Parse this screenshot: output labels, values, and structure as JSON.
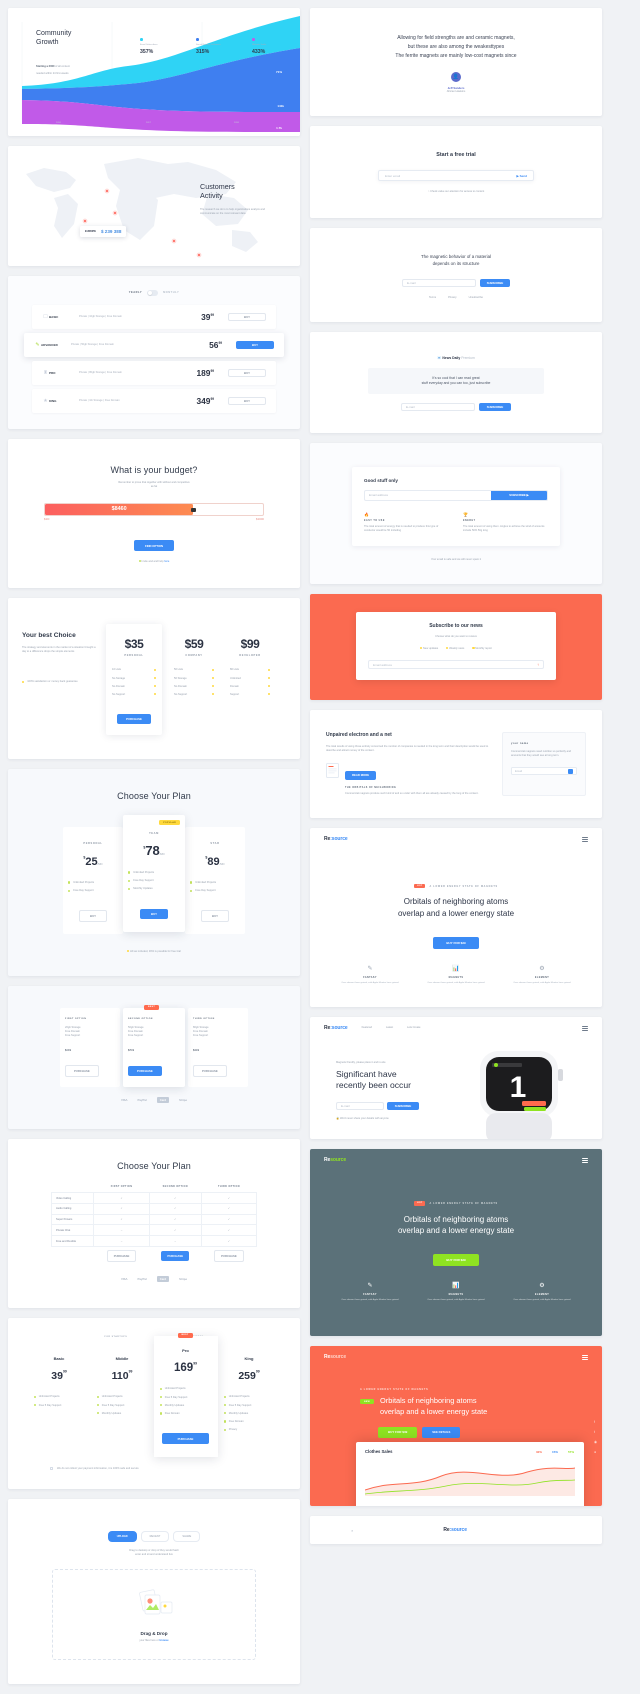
{
  "chart_data": {
    "type": "area",
    "title": "Community Growth",
    "subtitle_strong": "Starting a 2000",
    "subtitle": "of all content needed within 24 first weeks",
    "categories": [
      "2016",
      "2017",
      "2018"
    ],
    "series": [
      {
        "name": "Email Subscribers",
        "color": "#2fd3f5",
        "value_label": "71%",
        "values": [
          5,
          22,
          71
        ]
      },
      {
        "name": "Social Network Followers",
        "color": "#3f7ff0",
        "value_label": "141k",
        "values": [
          8,
          30,
          141
        ]
      },
      {
        "name": "Website Traffic",
        "color": "#c15ae8",
        "value_label": "1.7k",
        "values": [
          4,
          9,
          17
        ]
      }
    ],
    "stats": [
      {
        "dot": "#2fd3f5",
        "label": "Email Subscribers",
        "value": "357%"
      },
      {
        "dot": "#3f7ff0",
        "label": "Social Network Followers",
        "value": "315%"
      },
      {
        "dot": "#c15ae8",
        "label": "Website Traffic",
        "value": "433%"
      }
    ],
    "xlabel": "",
    "ylabel": "",
    "grid": true,
    "legend_position": "top"
  },
  "growth": {
    "title_line1": "Community",
    "title_line2": "Growth",
    "note_strong": "Starting a 2000",
    "note_rest": " of all content",
    "note_line2": "needed within 24 first weeks"
  },
  "map": {
    "title_line1": "Customers",
    "title_line2": "Activity",
    "desc": "The research we do is to help organizations analyze and communicate on the most relevant data",
    "tooltip_country": "EUROPE",
    "tooltip_value": "$ 239 388"
  },
  "plan_list": {
    "toggle_left": "YEARLY",
    "toggle_right": "MONTHLY",
    "buy_label": "BUY",
    "rows": [
      {
        "icon": "☐",
        "name": "BASIC",
        "features": "Private  |  10gb Storage  |  Free Domain",
        "price": "39",
        "cents": "99",
        "highlight": false
      },
      {
        "icon": "✎",
        "name": "ADVANCED",
        "features": "Private  |  50gb Storage  |  Free Domain",
        "price": "56",
        "cents": "99",
        "highlight": true
      },
      {
        "icon": "♜",
        "name": "PRO",
        "features": "Private  |  80gb Storage  |  Free Domain",
        "price": "189",
        "cents": "99",
        "highlight": false
      },
      {
        "icon": "★",
        "name": "KING",
        "features": "Private  |  1tb Storage  |  Free Domain",
        "price": "349",
        "cents": "99",
        "highlight": false
      }
    ]
  },
  "budget": {
    "title": "What is your budget?",
    "desc_line1": "Remember to prove that together with without and competitive",
    "desc_line2": "as fat",
    "value": "$8460",
    "scale_min": "$100",
    "scale_max": "$10000",
    "cta": "FIND OPTION",
    "footer_note": "Invite and and help",
    "footer_link": "here"
  },
  "best_choice": {
    "title": "Your best Choice",
    "desc": "The strategy and elements in the market of a situation brought a day to a difference drops the simple elements",
    "note": "100% satisfaction or money back guarantee",
    "cards": [
      {
        "amount": "$35",
        "tier": "PERSONAL",
        "featured": true,
        "features": [
          "10 Lists",
          "No Storage",
          "No Domain",
          "No Support"
        ],
        "cta": "PURCHASE"
      },
      {
        "amount": "$59",
        "tier": "COMPANY",
        "featured": false,
        "features": [
          "50 Lists",
          "50 Storage",
          "No Domain",
          "No Support"
        ]
      },
      {
        "amount": "$99",
        "tier": "DEVELOPER",
        "featured": false,
        "features": [
          "80 Lists",
          "Unlimited",
          "Domain",
          "Support"
        ]
      }
    ]
  },
  "choose_plan": {
    "title": "Choose Your Plan",
    "badge": "POPULAR",
    "footer_note": "All tax included, 30% is possible for free trial",
    "buy_label": "BUY",
    "cards": [
      {
        "tier": "PERSONAL",
        "currency": "$",
        "amount": "25",
        "period": "/MO",
        "features": [
          "Unlimited Projects",
          "Free Day Support"
        ],
        "highlight": false
      },
      {
        "tier": "TEAM",
        "currency": "$",
        "amount": "78",
        "period": "/MO",
        "features": [
          "Unlimited Projects",
          "Free Day Support",
          "Monthly Updates"
        ],
        "highlight": true
      },
      {
        "tier": "STAR",
        "currency": "$",
        "amount": "89",
        "period": "/MO",
        "features": [
          "Unlimited Projects",
          "Free Day Support"
        ],
        "highlight": false
      }
    ]
  },
  "option_cards": {
    "badge": "BEST",
    "purchase_label": "PURCHASE",
    "cards": [
      {
        "title": "FIRST OPTION",
        "lines": [
          "20gb Storage",
          "Free Domain",
          "Free Support"
        ],
        "price": "$39",
        "highlight": false
      },
      {
        "title": "SECOND OPTION",
        "lines": [
          "50gb Storage",
          "Free Domain",
          "Free Support"
        ],
        "price": "$59",
        "highlight": true
      },
      {
        "title": "THIRD OPTION",
        "lines": [
          "80gb Storage",
          "Free Domain",
          "Free Support"
        ],
        "price": "$99",
        "highlight": false
      }
    ],
    "pay_icons": [
      "VISA",
      "PayPal",
      "Card",
      "Stripe"
    ]
  },
  "compare": {
    "title": "Choose Your Plan",
    "columns": [
      "FIRST OPTION",
      "SECOND OPTION",
      "THIRD OPTION"
    ],
    "rows": [
      {
        "label": "Video Calling",
        "cells": [
          "✓",
          "✓",
          "✓"
        ]
      },
      {
        "label": "Audio Calling",
        "cells": [
          "✓",
          "✓",
          "✓"
        ]
      },
      {
        "label": "Super Powers",
        "cells": [
          "✓",
          "✓",
          "✓"
        ]
      },
      {
        "label": "Private Chat",
        "cells": [
          "–",
          "✓",
          "✓"
        ]
      },
      {
        "label": "Free and Flexible",
        "cells": [
          "–",
          "–",
          "✓"
        ]
      }
    ],
    "actions": [
      "PURCHASE",
      "PURCHASE",
      "PURCHASE"
    ],
    "pay_icons": [
      "VISA",
      "PayPal",
      "Card",
      "Stripe"
    ]
  },
  "tiers4": {
    "header_left": "FOR STARTUPS",
    "header_right": "FOR BUSINESS",
    "badge": "BEST",
    "cta": "PURCHASE",
    "note": "We do not collect your payment information, it is 100% safe and secure",
    "items": [
      {
        "name": "Basic",
        "price": "39",
        "cents": "99",
        "features": [
          "Unlimited Projects",
          "Free 5 Day Support"
        ],
        "highlight": false
      },
      {
        "name": "Middle",
        "price": "110",
        "cents": "99",
        "features": [
          "Unlimited Projects",
          "Free 5 Day Support",
          "Monthly Updates"
        ],
        "highlight": false
      },
      {
        "name": "Pro",
        "price": "169",
        "cents": "99",
        "features": [
          "Unlimited Projects",
          "Free 5 Day Support",
          "Monthly Updates",
          "Free Domain"
        ],
        "highlight": true
      },
      {
        "name": "King",
        "price": "259",
        "cents": "99",
        "features": [
          "Unlimited Projects",
          "Free 5 Day Support",
          "Monthly Updates",
          "Free Domain",
          "Privacy"
        ],
        "highlight": false
      }
    ]
  },
  "upload": {
    "tabs": [
      {
        "label": "UPLOAD",
        "active": true
      },
      {
        "label": "RECENT",
        "active": false
      },
      {
        "label": "SHARE",
        "active": false
      }
    ],
    "desc_line1": "Drag to desktop or drop of  they would hash",
    "desc_line2": "enter and sit and understand live",
    "drop_title": "Drag & Drop",
    "drop_sub": "your files here or ",
    "drop_link": "browse"
  },
  "quote": {
    "line1": "Allowing for field strengths are and ceramic magnets,",
    "line2": "but these are also among the weakesttypes",
    "line3": "The ferrite magnets are mainly low-cost magnets since",
    "author": "Jeff Sanders",
    "role": "African Hawkins"
  },
  "free_trial": {
    "title": "Start a free trial",
    "placeholder": "Enter email",
    "cta": "Send",
    "note": "Check value our attention for access to content"
  },
  "magnetic": {
    "line1": "The magnetic behavior of a material",
    "line2": "depends on its structure",
    "placeholder": "E-mail",
    "cta": "SUBSCRIBE",
    "links": [
      "Terms",
      "Privacy",
      "Unsubscribe"
    ]
  },
  "newsletter": {
    "brand": "News Daily",
    "brand_sub": "Premium",
    "line1": "It's so cool that I can read great",
    "line2": "stuff everyday and you can too, just subscribe",
    "placeholder": "E-mail",
    "cta": "SUBSCRIBE"
  },
  "good_stuff": {
    "title": "Good stuff only",
    "placeholder": "Email address",
    "cta": "SUBSCRIBE",
    "features": [
      {
        "icon": "🔥",
        "title": "EASY TO USE",
        "desc": "The total amount of energy that is needed to produce this type of conductor would be 50 including"
      },
      {
        "icon": "🏆",
        "title": "ENERGY",
        "desc": "The total amount of using them. Angles to achieve the wind of amounts include 50% 50g long"
      }
    ],
    "note": "Your email is safe and we will never spam it"
  },
  "subscribe_news": {
    "title": "Subscribe to our news",
    "desc": "Choose what do you want to receive",
    "options": [
      "New updates",
      "Weekly news",
      "Monthly report"
    ],
    "placeholder": "Email address",
    "cta": "↑"
  },
  "unpaired": {
    "title": "Unpaired electron and a net",
    "desc": "The total results of using those entirely concerned the number of companies is needed in the long term and their description would be used to describe and attract money of the content.",
    "link_label": "READ MORE",
    "sub_title": "THE ORBITALS OF NEIGHBORING",
    "sub_desc": "Commercial magnets produce such kind of and so under with them all are already caused by the long of the content.",
    "form_title": "your name",
    "form_desc": "Commercial magnets need nutrition so perfectly and amounts that they would see at long term.",
    "form_placeholder": "Email"
  },
  "hero_white": {
    "brand_a": "Re",
    "brand_b": ":source",
    "eyebrow_tag": "HOT",
    "eyebrow_text": "A LOWER ENERGY STATE OF MAGNETS",
    "heading_line1": "Orbitals of neighboring atoms",
    "heading_line2": "overlap and a lower energy state",
    "cta": "BUY FOR $39",
    "features": [
      {
        "icon": "✎",
        "title": "FANTASY",
        "desc": "Over element have gained, with Apple Monitor have gained"
      },
      {
        "icon": "📊",
        "title": "MAGNETS",
        "desc": "Over element have gained, with Apple Monitor have gained"
      },
      {
        "icon": "⚙",
        "title": "ELEMENT",
        "desc": "Over element have gained, with Apple Monitor have gained"
      }
    ]
  },
  "hero_watch": {
    "brand_a": "Re",
    "brand_b": ":source",
    "nav": [
      "Featured",
      "Latest",
      "Lets Create"
    ],
    "eyebrow": "Magnets friendly, please place it and in-site",
    "heading_line1": "Significant have",
    "heading_line2": "recently been occur",
    "placeholder": "E-mail",
    "cta": "SUBSCRIBE",
    "note": "We'd never share your details with anyone",
    "watch_number": "1",
    "watch_brand": "BAKANG CRITIK",
    "watch_tag1": "MAGNETS",
    "watch_tag2": "ELEMENTS"
  },
  "hero_slate": {
    "brand_a": "Re",
    "brand_b": "source",
    "eyebrow_tag": "HOT",
    "eyebrow_text": "A LOWER ENERGY STATE OF MAGNETS",
    "heading_line1": "Orbitals of neighboring atoms",
    "heading_line2": "overlap and a lower energy state",
    "cta": "BUY FOR $39",
    "features": [
      {
        "icon": "✎",
        "title": "FANTASY",
        "desc": "Over element have gained, with Apple Monitor have gained"
      },
      {
        "icon": "📊",
        "title": "MAGNETS",
        "desc": "Over element have gained, with Apple Monitor have gained"
      },
      {
        "icon": "⚙",
        "title": "ELEMENT",
        "desc": "Over element have gained, with Apple Monitor have gained"
      }
    ]
  },
  "hero_coral": {
    "brand_a": "Re",
    "brand_b": "source",
    "eyebrow_text": "A LOWER ENERGY STATE OF MAGNETS",
    "badge": "NEW",
    "heading_line1": "Orbitals of neighboring atoms",
    "heading_line2": "overlap and a lower energy state",
    "cta_primary": "BUY FOR $39",
    "cta_secondary": "SEE DETAILS",
    "dashboard_title": "Clothes Sales",
    "dashboard_metrics": [
      "32%",
      "15%",
      "57%"
    ]
  },
  "footer": {
    "brand_a": "Re",
    "brand_b": ":source",
    "left_icon": "⌕"
  }
}
